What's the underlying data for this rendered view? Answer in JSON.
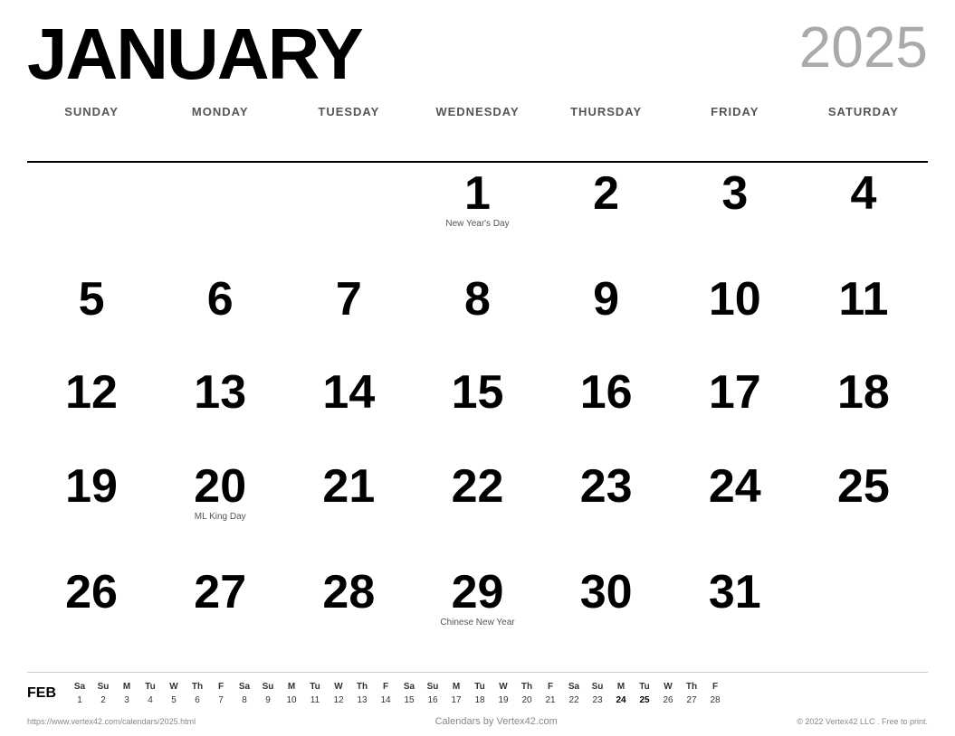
{
  "header": {
    "month": "JANUARY",
    "year": "2025"
  },
  "day_headers": [
    "SUNDAY",
    "MONDAY",
    "TUESDAY",
    "WEDNESDAY",
    "THURSDAY",
    "FRIDAY",
    "SATURDAY"
  ],
  "weeks": [
    [
      {
        "num": "",
        "event": ""
      },
      {
        "num": "",
        "event": ""
      },
      {
        "num": "",
        "event": ""
      },
      {
        "num": "1",
        "event": "New Year's Day"
      },
      {
        "num": "2",
        "event": ""
      },
      {
        "num": "3",
        "event": ""
      },
      {
        "num": "4",
        "event": ""
      }
    ],
    [
      {
        "num": "5",
        "event": ""
      },
      {
        "num": "6",
        "event": ""
      },
      {
        "num": "7",
        "event": ""
      },
      {
        "num": "8",
        "event": ""
      },
      {
        "num": "9",
        "event": ""
      },
      {
        "num": "10",
        "event": ""
      },
      {
        "num": "11",
        "event": ""
      }
    ],
    [
      {
        "num": "12",
        "event": ""
      },
      {
        "num": "13",
        "event": ""
      },
      {
        "num": "14",
        "event": ""
      },
      {
        "num": "15",
        "event": ""
      },
      {
        "num": "16",
        "event": ""
      },
      {
        "num": "17",
        "event": ""
      },
      {
        "num": "18",
        "event": ""
      }
    ],
    [
      {
        "num": "19",
        "event": ""
      },
      {
        "num": "20",
        "event": "ML King Day"
      },
      {
        "num": "21",
        "event": ""
      },
      {
        "num": "22",
        "event": ""
      },
      {
        "num": "23",
        "event": ""
      },
      {
        "num": "24",
        "event": ""
      },
      {
        "num": "25",
        "event": ""
      }
    ],
    [
      {
        "num": "26",
        "event": ""
      },
      {
        "num": "27",
        "event": ""
      },
      {
        "num": "28",
        "event": ""
      },
      {
        "num": "29",
        "event": "Chinese New Year"
      },
      {
        "num": "30",
        "event": ""
      },
      {
        "num": "31",
        "event": ""
      },
      {
        "num": "",
        "event": ""
      }
    ]
  ],
  "mini_calendar": {
    "label": "FEB",
    "headers": [
      "Sa",
      "Su",
      "M",
      "Tu",
      "W",
      "Th",
      "F",
      "Sa",
      "Su",
      "M",
      "Tu",
      "W",
      "Th",
      "F",
      "Sa",
      "Su",
      "M",
      "Tu",
      "W",
      "Th",
      "F",
      "Sa",
      "Su",
      "M",
      "Tu",
      "W",
      "Th",
      "F"
    ],
    "days": [
      "1",
      "2",
      "3",
      "4",
      "5",
      "6",
      "7",
      "8",
      "9",
      "10",
      "11",
      "12",
      "13",
      "14",
      "15",
      "16",
      "17",
      "18",
      "19",
      "20",
      "21",
      "22",
      "23",
      "24",
      "25",
      "26",
      "27",
      "28"
    ]
  },
  "footer": {
    "left": "https://www.vertex42.com/calendars/2025.html",
    "center": "Calendars by Vertex42.com",
    "right": "© 2022 Vertex42 LLC . Free to print."
  }
}
